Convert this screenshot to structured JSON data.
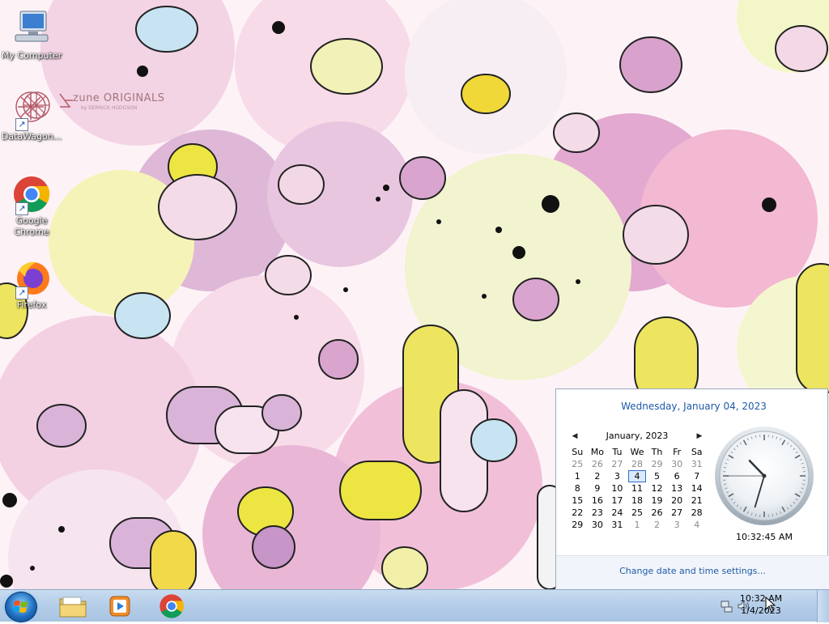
{
  "desktop": {
    "icons": [
      {
        "label": "My Computer",
        "shortcut": false
      },
      {
        "label": "DataWagon...",
        "shortcut": true
      },
      {
        "label": "Google Chrome",
        "shortcut": true
      },
      {
        "label": "Firefox",
        "shortcut": true
      }
    ],
    "wallpaper_logo": "zune ORIGINALS",
    "wallpaper_byline": "by DERRICK HODGSON"
  },
  "taskbar": {
    "pinned": [
      "start-orb",
      "file-explorer-icon",
      "media-player-icon",
      "chrome-icon"
    ],
    "tray": {
      "time": "10:32 AM",
      "date": "1/4/2023"
    }
  },
  "flyout": {
    "long_date": "Wednesday, January 04, 2023",
    "month_label": "January, 2023",
    "weekdays": [
      "Su",
      "Mo",
      "Tu",
      "We",
      "Th",
      "Fr",
      "Sa"
    ],
    "weeks": [
      [
        "25",
        "26",
        "27",
        "28",
        "29",
        "30",
        "31"
      ],
      [
        "1",
        "2",
        "3",
        "4",
        "5",
        "6",
        "7"
      ],
      [
        "8",
        "9",
        "10",
        "11",
        "12",
        "13",
        "14"
      ],
      [
        "15",
        "16",
        "17",
        "18",
        "19",
        "20",
        "21"
      ],
      [
        "22",
        "23",
        "24",
        "25",
        "26",
        "27",
        "28"
      ],
      [
        "29",
        "30",
        "31",
        "1",
        "2",
        "3",
        "4"
      ]
    ],
    "today": "4",
    "digital_time": "10:32:45 AM",
    "analog": {
      "hour": 10,
      "minute": 32,
      "second": 45
    },
    "change_link": "Change date and time settings..."
  },
  "colors": {
    "link": "#1e5aa8",
    "today_border": "#2f6fcf"
  }
}
